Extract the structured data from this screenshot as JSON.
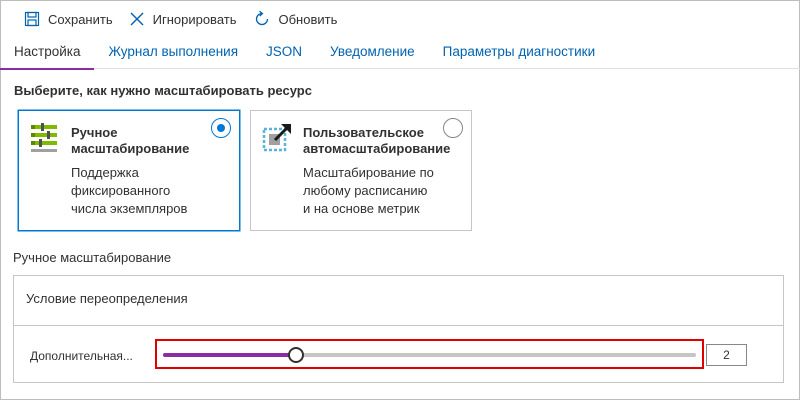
{
  "toolbar": {
    "save_label": "Сохранить",
    "discard_label": "Игнорировать",
    "refresh_label": "Обновить"
  },
  "tabs": [
    {
      "label": "Настройка",
      "active": true
    },
    {
      "label": "Журнал выполнения"
    },
    {
      "label": "JSON"
    },
    {
      "label": "Уведомление"
    },
    {
      "label": "Параметры диагностики"
    }
  ],
  "section_title": "Выберите, как нужно масштабировать ресурс",
  "options": [
    {
      "title": "Ручное масштабирование",
      "description": [
        "Поддержка",
        "фиксированного",
        "числа экземпляров"
      ],
      "selected": true,
      "icon": "manual-scale-icon"
    },
    {
      "title": "Пользовательское автомасштабирование",
      "description": [
        "Масштабирование по",
        "любому расписанию",
        "и на основе метрик"
      ],
      "selected": false,
      "icon": "autoscale-icon"
    }
  ],
  "manual": {
    "label": "Ручное масштабирование",
    "override_label": "Условие переопределения",
    "instance_label": "Дополнительная...",
    "instance_count": "2",
    "slider_fraction": 0.25
  },
  "colors": {
    "accent": "#8a2da5",
    "link": "#0063b1",
    "selected_border": "#0078d4",
    "highlight": "#e00000"
  }
}
